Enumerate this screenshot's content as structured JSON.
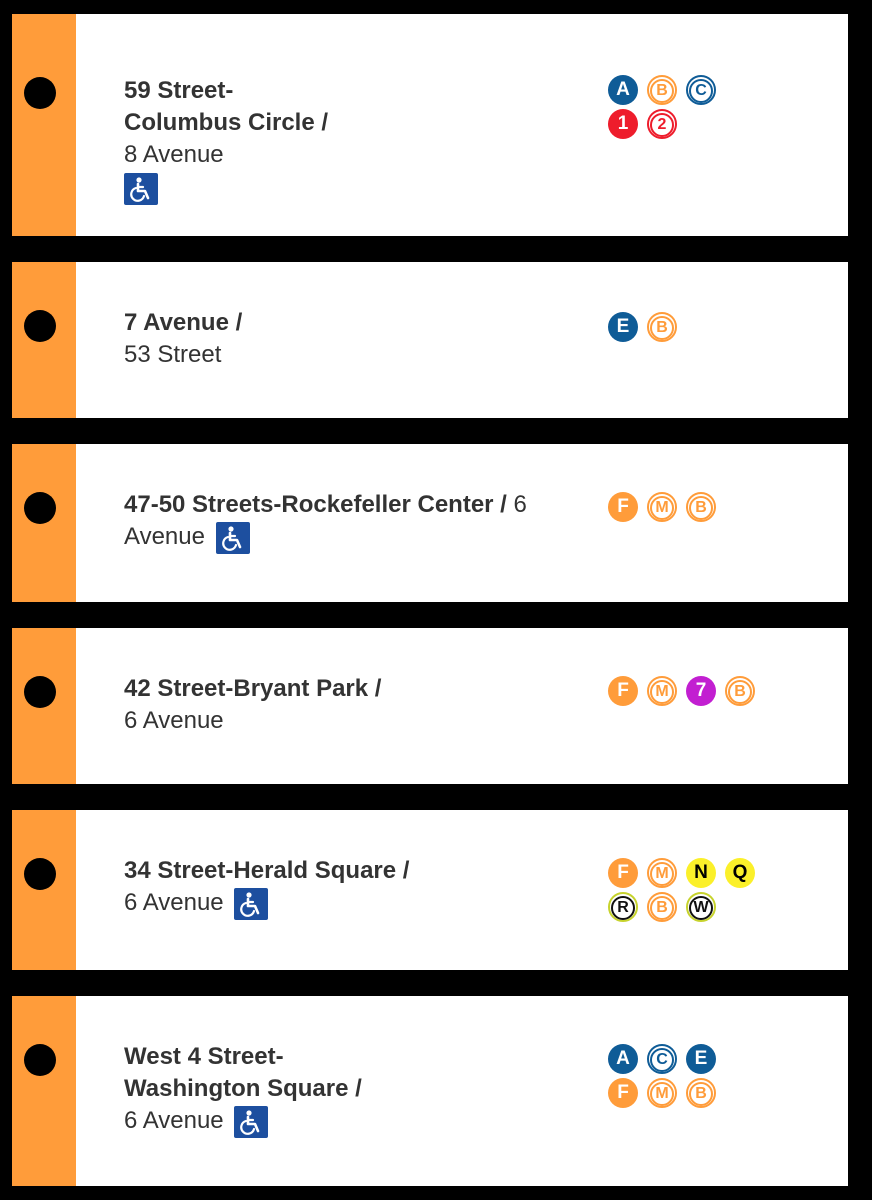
{
  "colors": {
    "background": "#000000",
    "card": "#ffffff",
    "line_stripe": "#ff9c3a",
    "route_blue": "#0f5c97",
    "route_orange": "#ff9c3a",
    "route_red": "#ee1d2c",
    "route_purple": "#c21fd1",
    "route_yellow": "#fbf02a",
    "ada_blue": "#1d4f9f",
    "text": "#333333"
  },
  "stations": [
    {
      "name_bold": "59 Street-\nColumbus Circle /",
      "name_rest": "8 Avenue",
      "accessible": true,
      "routes": [
        [
          {
            "label": "A",
            "style": "filled",
            "color": "route_blue"
          },
          {
            "label": "B",
            "style": "hollow",
            "color": "route_orange"
          },
          {
            "label": "C",
            "style": "hollow",
            "color": "route_blue"
          }
        ],
        [
          {
            "label": "1",
            "style": "filled",
            "color": "route_red"
          },
          {
            "label": "2",
            "style": "hollow",
            "color": "route_red"
          }
        ]
      ]
    },
    {
      "name_bold": "7 Avenue /",
      "name_rest": "53 Street",
      "accessible": false,
      "routes": [
        [
          {
            "label": "E",
            "style": "filled",
            "color": "route_blue"
          },
          {
            "label": "B",
            "style": "hollow",
            "color": "route_orange"
          }
        ]
      ]
    },
    {
      "name_bold": "47-50 Streets-Rockefeller Center /",
      "name_rest": "6 Avenue",
      "accessible": true,
      "routes": [
        [
          {
            "label": "F",
            "style": "filled",
            "color": "route_orange"
          },
          {
            "label": "M",
            "style": "hollow",
            "color": "route_orange"
          },
          {
            "label": "B",
            "style": "hollow",
            "color": "route_orange"
          }
        ]
      ]
    },
    {
      "name_bold": "42 Street-Bryant Park /",
      "name_rest": "6 Avenue",
      "accessible": false,
      "routes": [
        [
          {
            "label": "F",
            "style": "filled",
            "color": "route_orange"
          },
          {
            "label": "M",
            "style": "hollow",
            "color": "route_orange"
          },
          {
            "label": "7",
            "style": "filled",
            "color": "route_purple"
          },
          {
            "label": "B",
            "style": "hollow",
            "color": "route_orange"
          }
        ]
      ]
    },
    {
      "name_bold": "34 Street-Herald Square /",
      "name_rest": "6 Avenue",
      "accessible": true,
      "routes": [
        [
          {
            "label": "F",
            "style": "filled",
            "color": "route_orange"
          },
          {
            "label": "M",
            "style": "hollow",
            "color": "route_orange"
          },
          {
            "label": "N",
            "style": "filled-dark",
            "color": "route_yellow"
          },
          {
            "label": "Q",
            "style": "filled-dark",
            "color": "route_yellow"
          }
        ],
        [
          {
            "label": "R",
            "style": "hollow-dark",
            "color": "route_yellow"
          },
          {
            "label": "B",
            "style": "hollow",
            "color": "route_orange"
          },
          {
            "label": "W",
            "style": "hollow-dark",
            "color": "route_yellow"
          }
        ]
      ]
    },
    {
      "name_bold": "West 4 Street-\nWashington Square /",
      "name_rest": "6 Avenue",
      "accessible": true,
      "routes": [
        [
          {
            "label": "A",
            "style": "filled",
            "color": "route_blue"
          },
          {
            "label": "C",
            "style": "hollow",
            "color": "route_blue"
          },
          {
            "label": "E",
            "style": "filled",
            "color": "route_blue"
          }
        ],
        [
          {
            "label": "F",
            "style": "filled",
            "color": "route_orange"
          },
          {
            "label": "M",
            "style": "hollow",
            "color": "route_orange"
          },
          {
            "label": "B",
            "style": "hollow",
            "color": "route_orange"
          }
        ]
      ]
    }
  ]
}
